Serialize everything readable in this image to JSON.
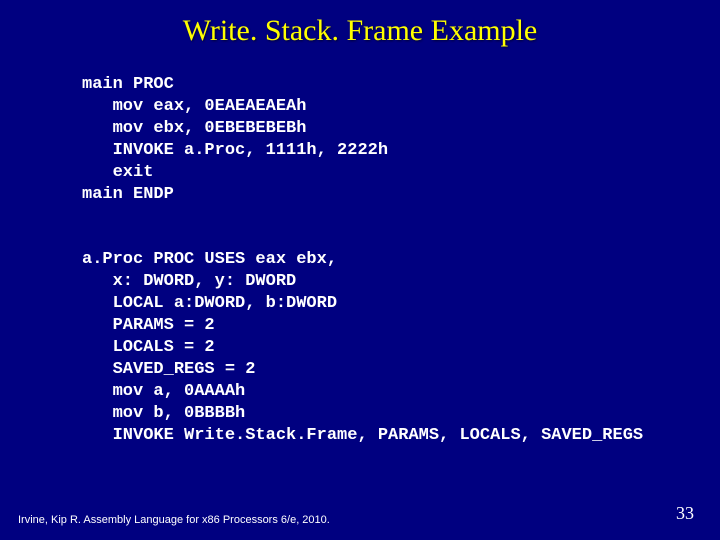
{
  "title": "Write. Stack. Frame Example",
  "code1": "main PROC\n   mov eax, 0EAEAEAEAh\n   mov ebx, 0EBEBEBEBh\n   INVOKE a.Proc, 1111h, 2222h\n   exit\nmain ENDP",
  "code2": "a.Proc PROC USES eax ebx,\n   x: DWORD, y: DWORD\n   LOCAL a:DWORD, b:DWORD\n   PARAMS = 2\n   LOCALS = 2\n   SAVED_REGS = 2\n   mov a, 0AAAAh\n   mov b, 0BBBBh\n   INVOKE Write.Stack.Frame, PARAMS, LOCALS, SAVED_REGS",
  "footer": "Irvine, Kip R. Assembly Language for x86 Processors 6/e, 2010.",
  "pagenum": "33"
}
